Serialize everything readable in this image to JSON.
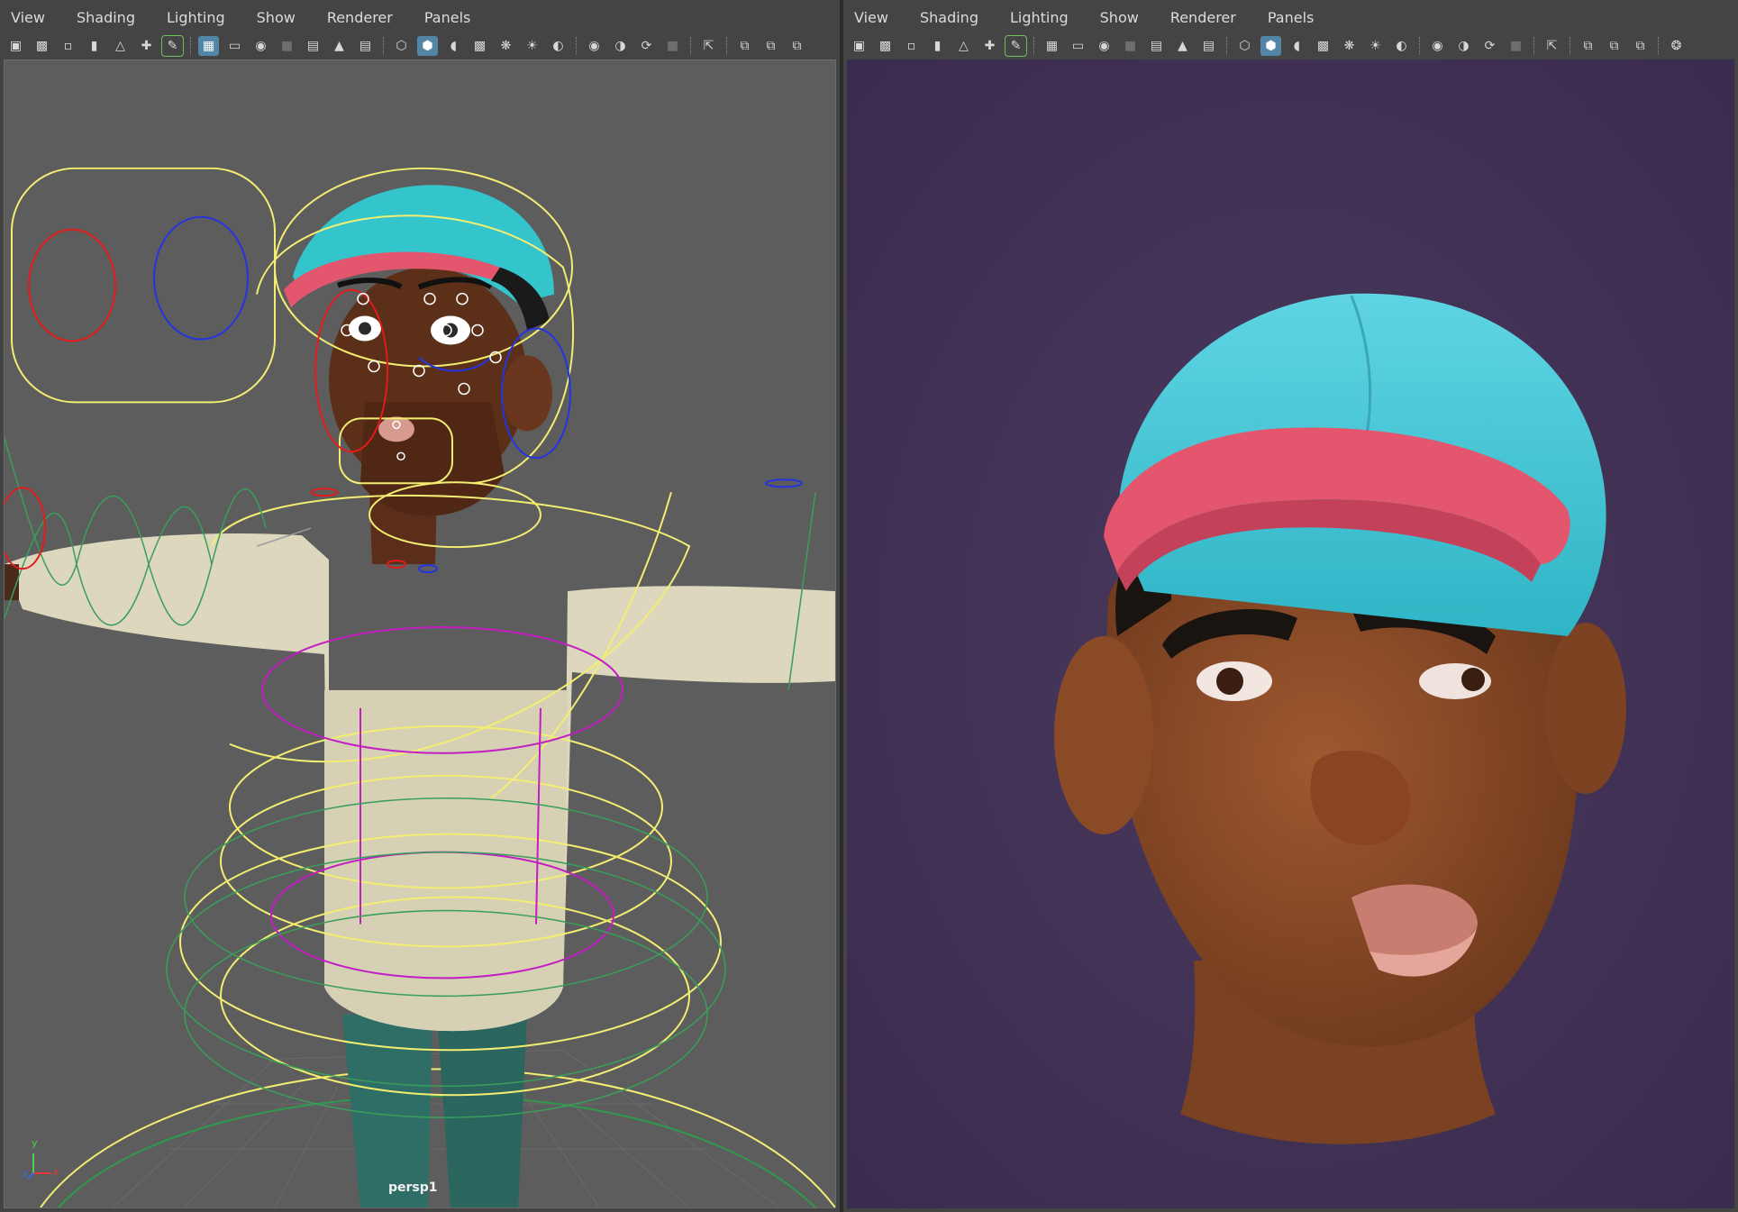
{
  "left_panel": {
    "menu": [
      "View",
      "Shading",
      "Lighting",
      "Show",
      "Renderer",
      "Panels"
    ],
    "toolbar_icons": [
      "camera-icon",
      "camera-attr-icon",
      "bookmark-camera-icon",
      "bookmark-icon",
      "image-plane-icon",
      "pivot-icon",
      "grease-pencil-icon",
      "grid-icon",
      "film-gate-icon",
      "resolution-gate-icon",
      "gate-mask-icon",
      "field-chart-icon",
      "safe-action-icon",
      "safe-title-icon",
      "wireframe-icon",
      "smooth-shade-icon",
      "wireframe-on-shaded-icon",
      "textured-icon",
      "xray-icon",
      "lights-icon",
      "shadows-icon",
      "ambient-occlusion-icon",
      "motion-blur-icon",
      "anti-alias-icon",
      "depth-of-field-icon",
      "isolate-select-icon",
      "xray-joints-icon",
      "xray-active-icon",
      "backface-icon",
      "frame-icon"
    ],
    "camera_label": "persp1",
    "axis_labels": {
      "y": "y",
      "x": "x",
      "z": "z"
    }
  },
  "right_panel": {
    "menu": [
      "View",
      "Shading",
      "Lighting",
      "Show",
      "Renderer",
      "Panels"
    ],
    "toolbar_icons": [
      "camera-icon",
      "camera-attr-icon",
      "bookmark-camera-icon",
      "bookmark-icon",
      "image-plane-icon",
      "pivot-icon",
      "grease-pencil-icon",
      "grid-icon",
      "film-gate-icon",
      "resolution-gate-icon",
      "gate-mask-icon",
      "field-chart-icon",
      "safe-action-icon",
      "safe-title-icon",
      "wireframe-icon",
      "smooth-shade-icon",
      "wireframe-on-shaded-icon",
      "textured-icon",
      "xray-icon",
      "lights-icon",
      "shadows-icon",
      "ambient-occlusion-icon",
      "motion-blur-icon",
      "anti-alias-icon",
      "depth-of-field-icon",
      "isolate-select-icon",
      "xray-joints-icon",
      "xray-active-icon",
      "backface-icon",
      "frame-icon",
      "render-icon"
    ]
  },
  "colors": {
    "ui_bg": "#444444",
    "viewport_bg": "#5d5d5d",
    "render_bg": "#3e2f52",
    "cap": "#33c4cc",
    "cap_brim": "#e4566e",
    "skin": "#8a4a2a",
    "shirt": "#dcd7bd",
    "pants": "#2f6e66",
    "ctrl_yellow": "#f3ee72",
    "ctrl_red": "#e21b1b",
    "ctrl_blue": "#2434e0",
    "ctrl_green": "#3a9e5b",
    "ctrl_magenta": "#c21ec2"
  }
}
